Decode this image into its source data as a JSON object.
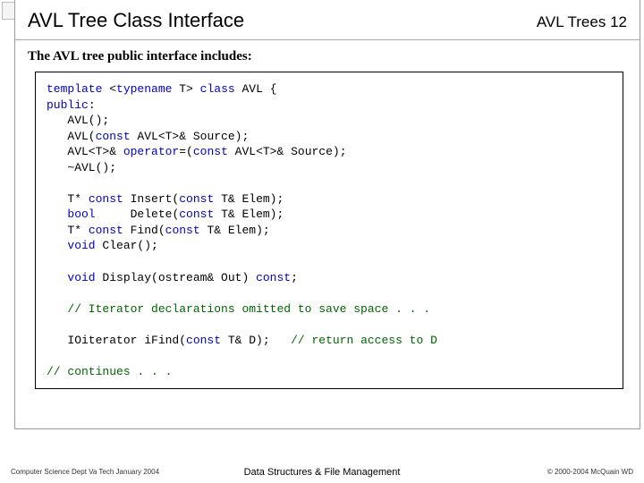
{
  "header": {
    "title": "AVL Tree Class Interface",
    "page_label": "AVL Trees",
    "page_number": "12"
  },
  "subtitle": "The AVL tree public interface includes:",
  "code": {
    "l01a": "template",
    "l01b": " <",
    "l01c": "typename",
    "l01d": " T> ",
    "l01e": "class",
    "l01f": " AVL {",
    "l02a": "public",
    "l02b": ":",
    "l03": "   AVL();",
    "l04a": "   AVL(",
    "l04b": "const",
    "l04c": " AVL<T>& Source);",
    "l05a": "   AVL<T>& ",
    "l05b": "operator",
    "l05c": "=(",
    "l05d": "const",
    "l05e": " AVL<T>& Source);",
    "l06": "   ~AVL();",
    "l07a": "   T* ",
    "l07b": "const",
    "l07c": " Insert(",
    "l07d": "const",
    "l07e": " T& Elem);",
    "l08a": "   ",
    "l08b": "bool",
    "l08c": "     Delete(",
    "l08d": "const",
    "l08e": " T& Elem);",
    "l09a": "   T* ",
    "l09b": "const",
    "l09c": " Find(",
    "l09d": "const",
    "l09e": " T& Elem);",
    "l10a": "   ",
    "l10b": "void",
    "l10c": " Clear();",
    "l11a": "   ",
    "l11b": "void",
    "l11c": " Display(ostream& Out) ",
    "l11d": "const",
    "l11e": ";",
    "l12a": "   ",
    "l12b": "// Iterator declarations omitted to save space . . .",
    "l13a": "   IOiterator iFind(",
    "l13b": "const",
    "l13c": " T& D);   ",
    "l13d": "// return access to D",
    "l14a": "// continues . . ."
  },
  "footer": {
    "left": "Computer Science Dept Va Tech January 2004",
    "center": "Data Structures & File Management",
    "right": "© 2000-2004 McQuain WD"
  }
}
